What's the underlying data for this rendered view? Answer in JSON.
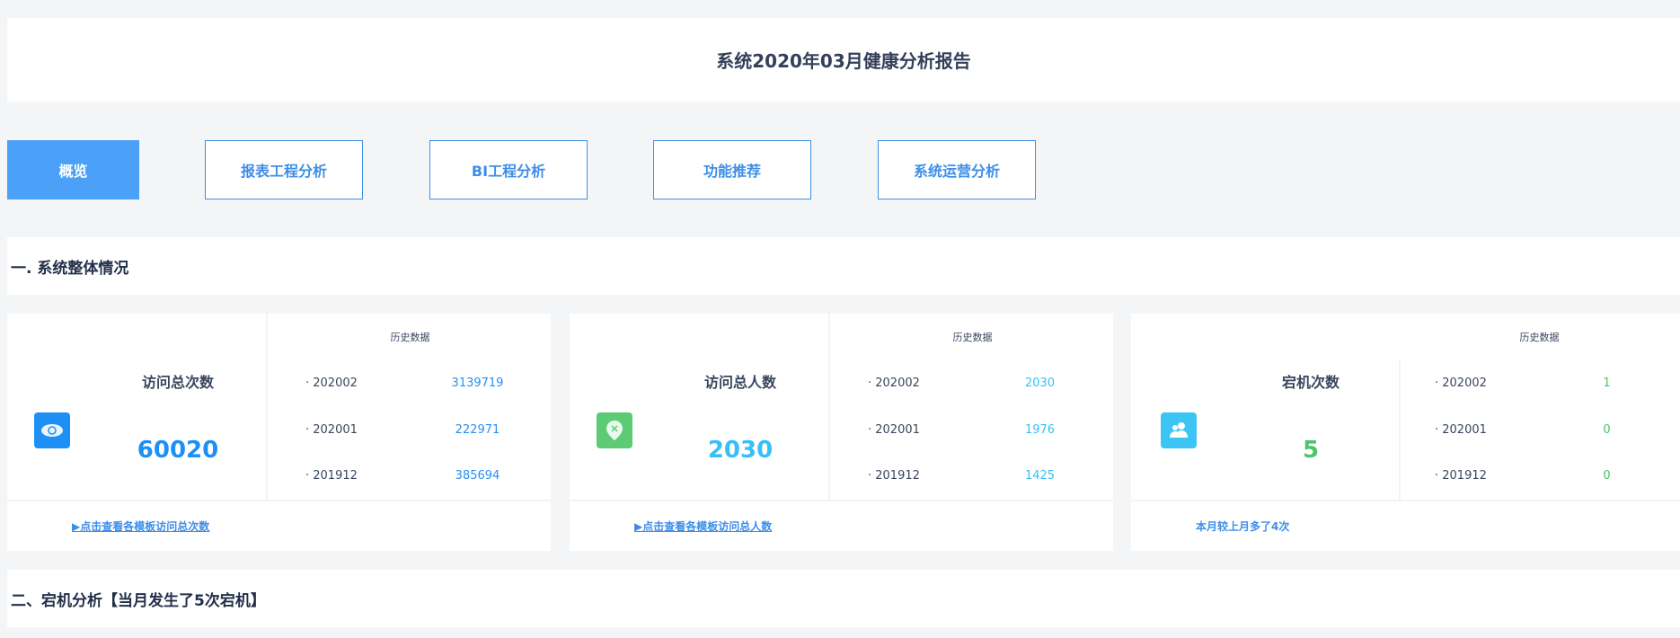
{
  "header": {
    "title": "系统2020年03月健康分析报告"
  },
  "tabs": [
    {
      "label": "概览"
    },
    {
      "label": "报表工程分析"
    },
    {
      "label": "BI工程分析"
    },
    {
      "label": "功能推荐"
    },
    {
      "label": "系统运营分析"
    }
  ],
  "section1": {
    "title": "一. 系统整体情况"
  },
  "section2": {
    "title": "二、宕机分析【当月发生了5次宕机】"
  },
  "cards": [
    {
      "title": "访问总次数",
      "value": "60020",
      "icon": "eye-icon",
      "color": "#1e90f5",
      "hist_label": "历史数据",
      "history": [
        {
          "period": "· 202002",
          "value": "3139719"
        },
        {
          "period": "· 202001",
          "value": "222971"
        },
        {
          "period": "· 201912",
          "value": "385694"
        }
      ],
      "footer": "▶点击查看各模板访问总次数"
    },
    {
      "title": "访问总人数",
      "value": "2030",
      "icon": "location-icon",
      "color": "#36c0f5",
      "hist_label": "历史数据",
      "history": [
        {
          "period": "· 202002",
          "value": "2030"
        },
        {
          "period": "· 202001",
          "value": "1976"
        },
        {
          "period": "· 201912",
          "value": "1425"
        }
      ],
      "footer": "▶点击查看各模板访问总人数"
    },
    {
      "title": "宕机次数",
      "value": "5",
      "icon": "users-icon",
      "color": "#4cc46a",
      "hist_label": "历史数据",
      "history": [
        {
          "period": "· 202002",
          "value": "1"
        },
        {
          "period": "· 202001",
          "value": "0"
        },
        {
          "period": "· 201912",
          "value": "0"
        }
      ],
      "footer": "本月较上月多了4次"
    }
  ]
}
